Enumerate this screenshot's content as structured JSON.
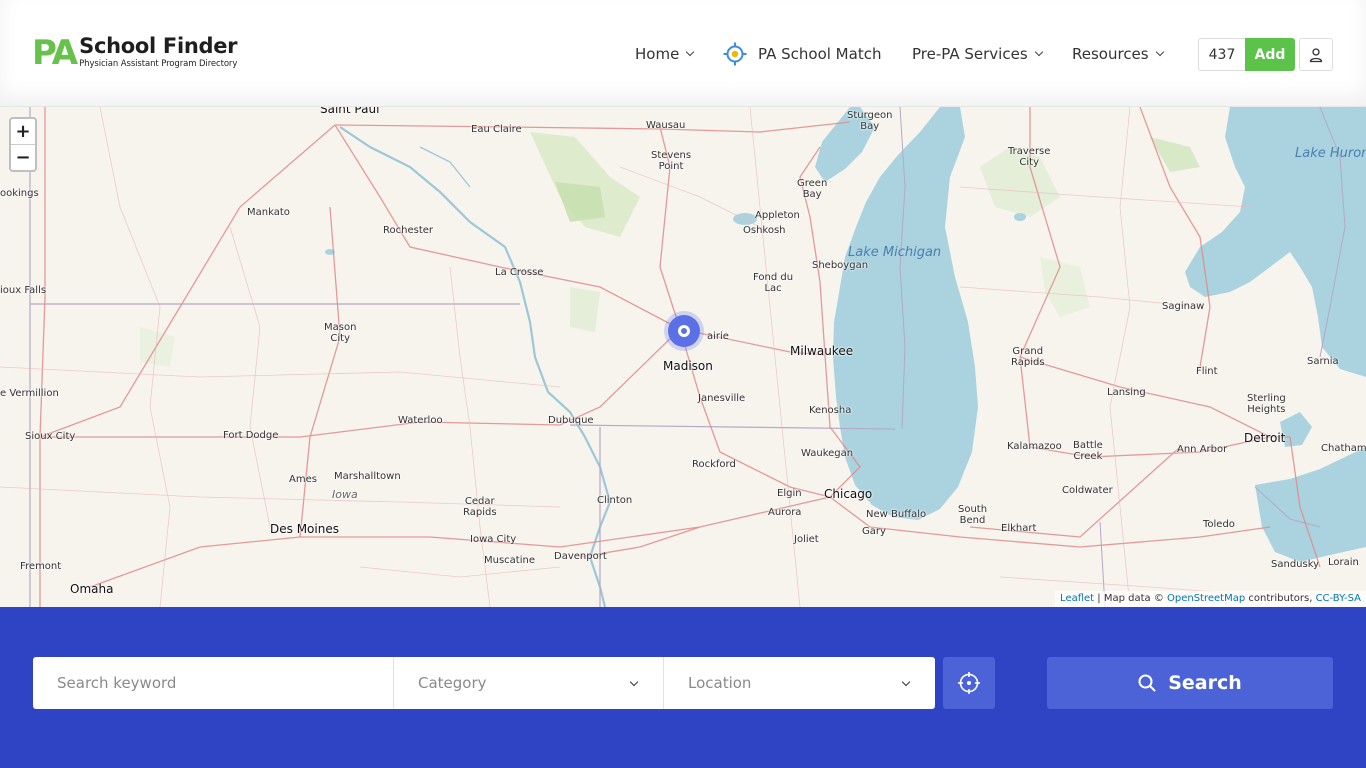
{
  "logo": {
    "mark": "PA",
    "title": "School Finder",
    "subtitle": "Physician Assistant Program Directory"
  },
  "nav": {
    "items": [
      {
        "label": "Home",
        "has_dropdown": true
      },
      {
        "label": "PA School Match",
        "icon": "crosshair-target-icon"
      },
      {
        "label": "Pre-PA Services",
        "has_dropdown": true
      },
      {
        "label": "Resources",
        "has_dropdown": true
      }
    ],
    "count": "437",
    "add_label": "Add",
    "user_icon": "user-icon"
  },
  "map": {
    "zoom_in": "+",
    "zoom_out": "−",
    "labels": {
      "saint_paul": "Saint Paul",
      "eau_claire": "Eau Claire",
      "wausau": "Wausau",
      "sturgeon_bay": "Sturgeon\nBay",
      "traverse_city": "Traverse\nCity",
      "lake_huron": "Lake Huron",
      "brookings": "ookings",
      "mankato": "Mankato",
      "rochester": "Rochester",
      "stevens_point": "Stevens\nPoint",
      "green_bay": "Green\nBay",
      "appleton": "Appleton",
      "oshkosh": "Oshkosh",
      "lake_michigan": "Lake Michigan",
      "sheboygan": "Sheboygan",
      "fond_du_lac": "Fond du\nLac",
      "la_crosse": "La Crosse",
      "sioux_falls": "ioux Falls",
      "saginaw": "Saginaw",
      "mason_city": "Mason\nCity",
      "sun_prairie": "airie",
      "milwaukee": "Milwaukee",
      "madison": "Madison",
      "grand_rapids": "Grand\nRapids",
      "flint": "Flint",
      "sarnia": "Sarnia",
      "vermillion": "e Vermillion",
      "janesville": "Janesville",
      "lansing": "Lansing",
      "sterling_heights": "Sterling\nHeights",
      "kenosha": "Kenosha",
      "waterloo": "Waterloo",
      "dubuque": "Dubuque",
      "sioux_city": "Sioux City",
      "fort_dodge": "Fort Dodge",
      "detroit": "Detroit",
      "kalamazoo": "Kalamazoo",
      "battle_creek": "Battle\nCreek",
      "ann_arbor": "Ann Arbor",
      "chatham": "Chatham",
      "rockford": "Rockford",
      "waukegan": "Waukegan",
      "ames": "Ames",
      "marshalltown": "Marshalltown",
      "iowa": "Iowa",
      "coldwater": "Coldwater",
      "elgin": "Elgin",
      "chicago": "Chicago",
      "cedar_rapids": "Cedar\nRapids",
      "clinton": "Clinton",
      "aurora": "Aurora",
      "south_bend": "South\nBend",
      "new_buffalo": "New Buffalo",
      "elkhart": "Elkhart",
      "toledo": "Toledo",
      "des_moines": "Des Moines",
      "iowa_city": "Iowa City",
      "joliet": "Joliet",
      "gary": "Gary",
      "fremont": "Fremont",
      "muscatine": "Muscatine",
      "davenport": "Davenport",
      "sandusky": "Sandusky",
      "lorain": "Lorain",
      "omaha": "Omaha"
    },
    "attribution": {
      "leaflet": "Leaflet",
      "sep1": " | Map data © ",
      "osm": "OpenStreetMap",
      "contributors": " contributors, ",
      "license": "CC-BY-SA"
    }
  },
  "search": {
    "keyword_placeholder": "Search keyword",
    "category_label": "Category",
    "location_label": "Location",
    "locate_icon": "crosshair-icon",
    "button_label": "Search"
  },
  "colors": {
    "brand_green": "#5bc24a",
    "band_blue": "#2e44c4",
    "button_blue": "#4b63d6",
    "marker_blue": "#5b70e6",
    "water": "#aad3df"
  }
}
